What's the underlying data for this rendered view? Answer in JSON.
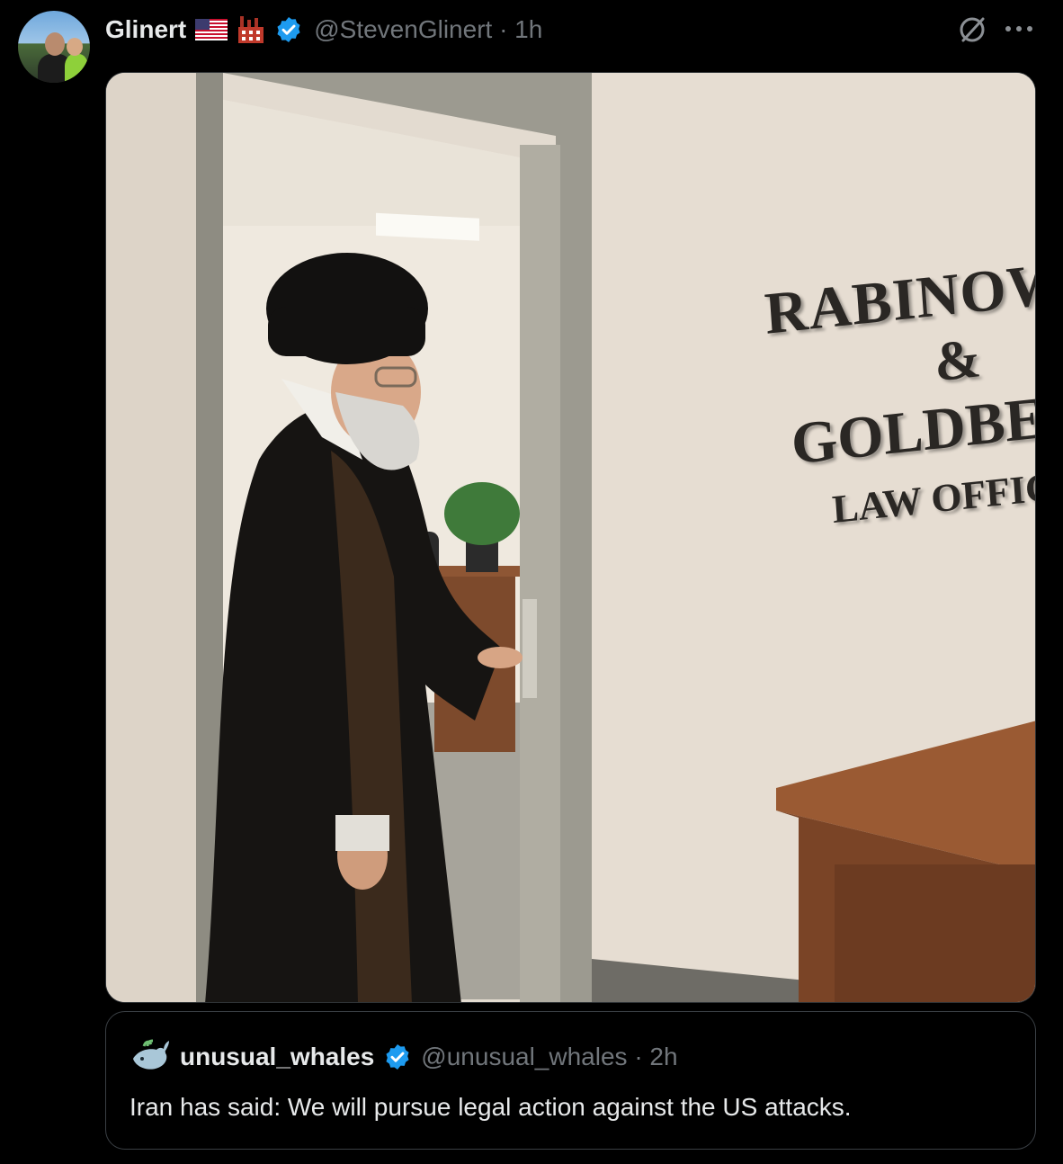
{
  "post": {
    "author_name": "Glinert",
    "handle_time": "@StevenGlinert · 1h"
  },
  "image_sign": {
    "line1": "RABINOWITZ",
    "line2": "&",
    "line3": "GOLDBERG",
    "line4": "LAW OFFICES"
  },
  "quoted_post": {
    "author_name": "unusual_whales",
    "handle_time": "@unusual_whales · 2h",
    "text": "Iran has said: We will pursue legal action against the US attacks."
  },
  "colors": {
    "background": "#000000",
    "verified": "#1d9bf0",
    "muted_text": "#71767b",
    "primary_text": "#e7e9ea"
  },
  "icons": [
    "avatar",
    "us-flag-icon",
    "factory-icon",
    "verified-badge-icon",
    "grok-icon",
    "more-icon",
    "whale-icon"
  ]
}
